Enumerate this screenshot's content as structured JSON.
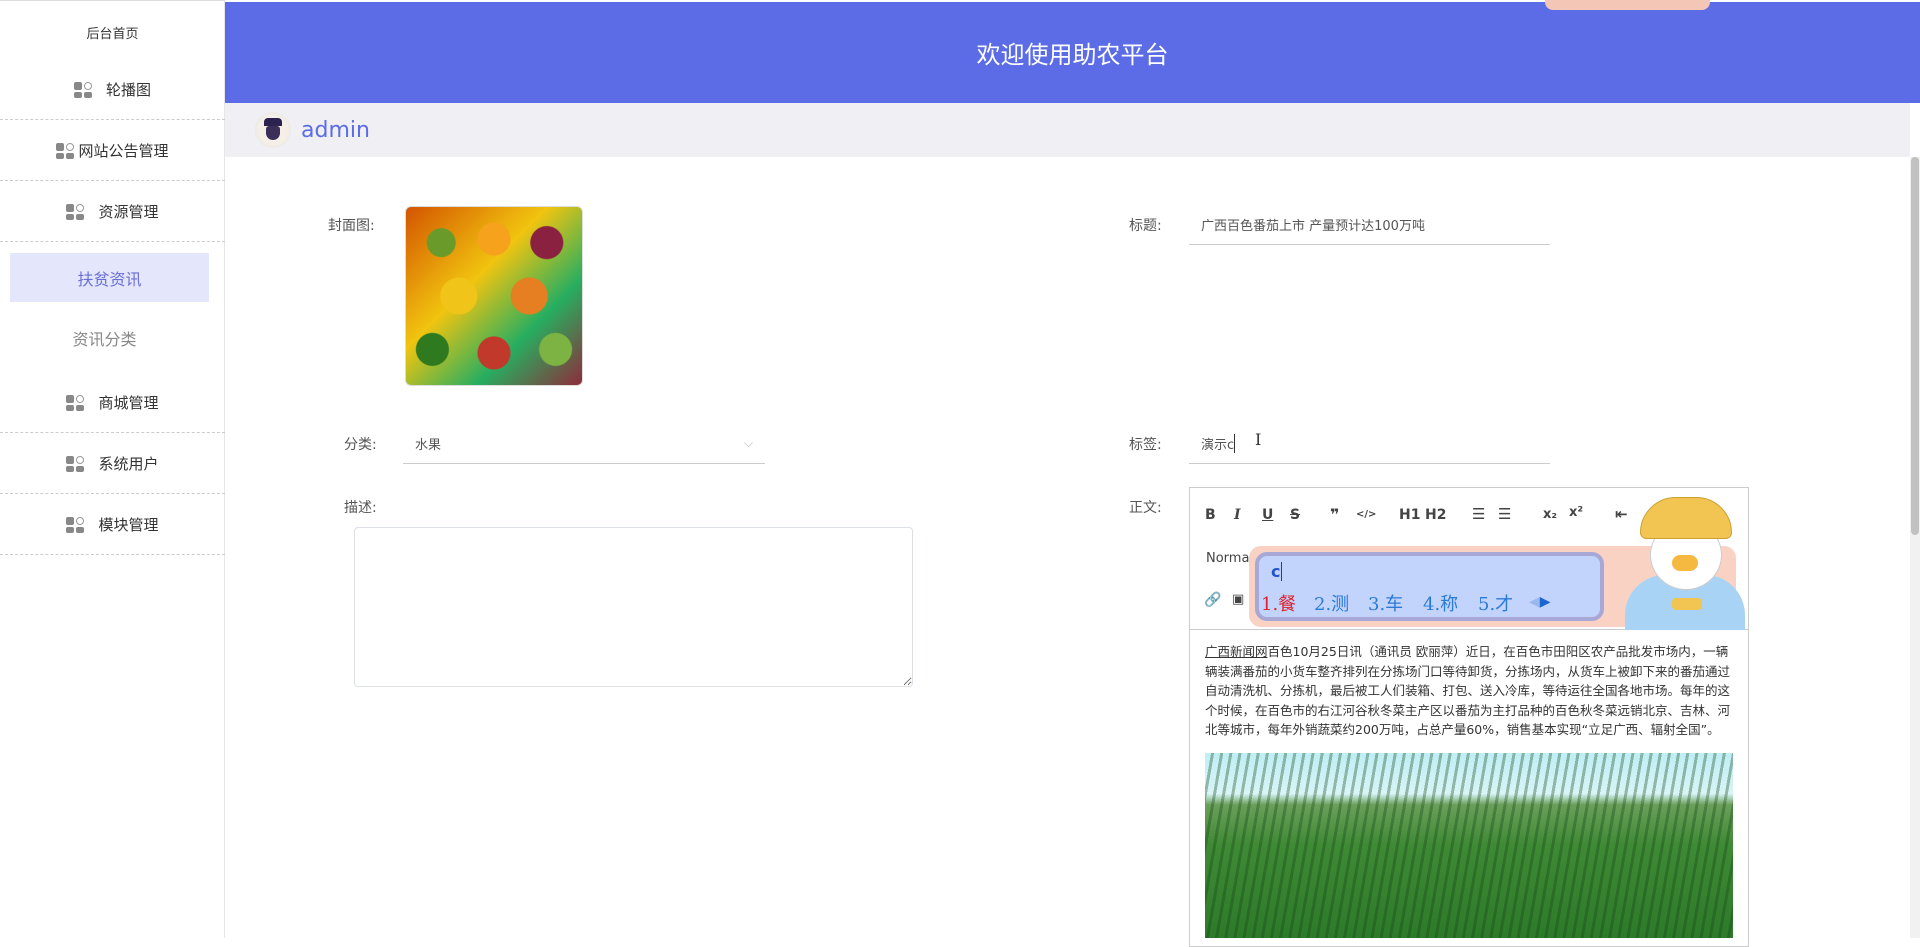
{
  "sidebar": {
    "items": [
      {
        "label": "后台首页"
      },
      {
        "label": "轮播图",
        "icon": "grid-icon"
      },
      {
        "label": "网站公告管理",
        "icon": "grid-icon"
      },
      {
        "label": "资源管理",
        "icon": "grid-icon"
      },
      {
        "label": "扶贫资讯",
        "active": true
      },
      {
        "label": "资讯分类"
      },
      {
        "label": "商城管理",
        "icon": "grid-icon"
      },
      {
        "label": "系统用户",
        "icon": "grid-icon"
      },
      {
        "label": "模块管理",
        "icon": "grid-icon"
      }
    ]
  },
  "header": {
    "title": "欢迎使用助农平台",
    "accent": "#5b6ce6"
  },
  "user": {
    "name": "admin"
  },
  "form": {
    "cover_label": "封面图:",
    "title_label": "标题:",
    "title_value": "广西百色番茄上市 产量预计达100万吨",
    "category_label": "分类:",
    "category_value": "水果",
    "tags_label": "标签:",
    "tags_value": "演示c",
    "desc_label": "描述:",
    "desc_value": "",
    "content_label": "正文:"
  },
  "editor": {
    "toolbar": [
      "B",
      "I",
      "U",
      "S",
      "❞",
      "</>",
      "H1",
      "H2",
      "ordered-list",
      "bullet-list",
      "x₂",
      "x²",
      "outdent"
    ],
    "header_select": "Normal",
    "source_link": "广西新闻网",
    "content": "百色10月25日讯（通讯员 欧丽萍）近日，在百色市田阳区农产品批发市场内，一辆辆装满番茄的小货车整齐排列在分拣场门口等待卸货，分拣场内，从货车上被卸下来的番茄通过自动清洗机、分拣机，最后被工人们装箱、打包、送入冷库，等待运往全国各地市场。每年的这个时候，在百色市的右江河谷秋冬菜主产区以番茄为主打品种的百色秋冬菜远销北京、吉林、河北等城市，每年外销蔬菜约200万吨，占总产量60%，销售基本实现“立足广西、辐射全国”。"
  },
  "ime": {
    "composition": "c",
    "candidates": [
      "1.餐",
      "2.测",
      "3.车",
      "4.称",
      "5.才"
    ]
  }
}
